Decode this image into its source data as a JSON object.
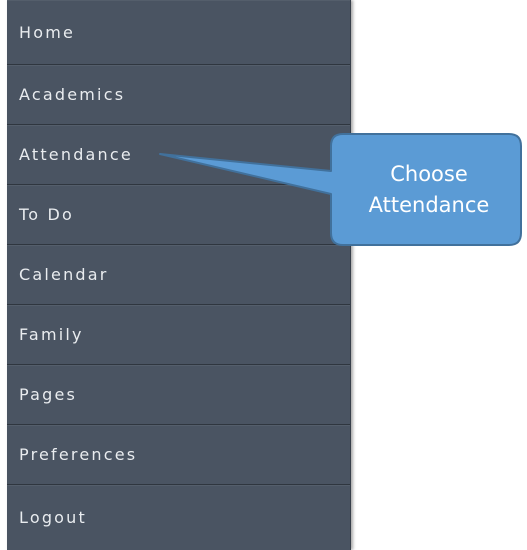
{
  "menu": {
    "items": [
      {
        "label": "Home"
      },
      {
        "label": "Academics"
      },
      {
        "label": "Attendance"
      },
      {
        "label": "To Do"
      },
      {
        "label": "Calendar"
      },
      {
        "label": "Family"
      },
      {
        "label": "Pages"
      },
      {
        "label": "Preferences"
      },
      {
        "label": "Logout"
      }
    ]
  },
  "callout": {
    "line1": "Choose",
    "line2": "Attendance",
    "fill_color": "#5b9bd5",
    "border_color": "#41719c"
  },
  "colors": {
    "menu_background": "#4a5462",
    "menu_text": "#e9ecef"
  }
}
